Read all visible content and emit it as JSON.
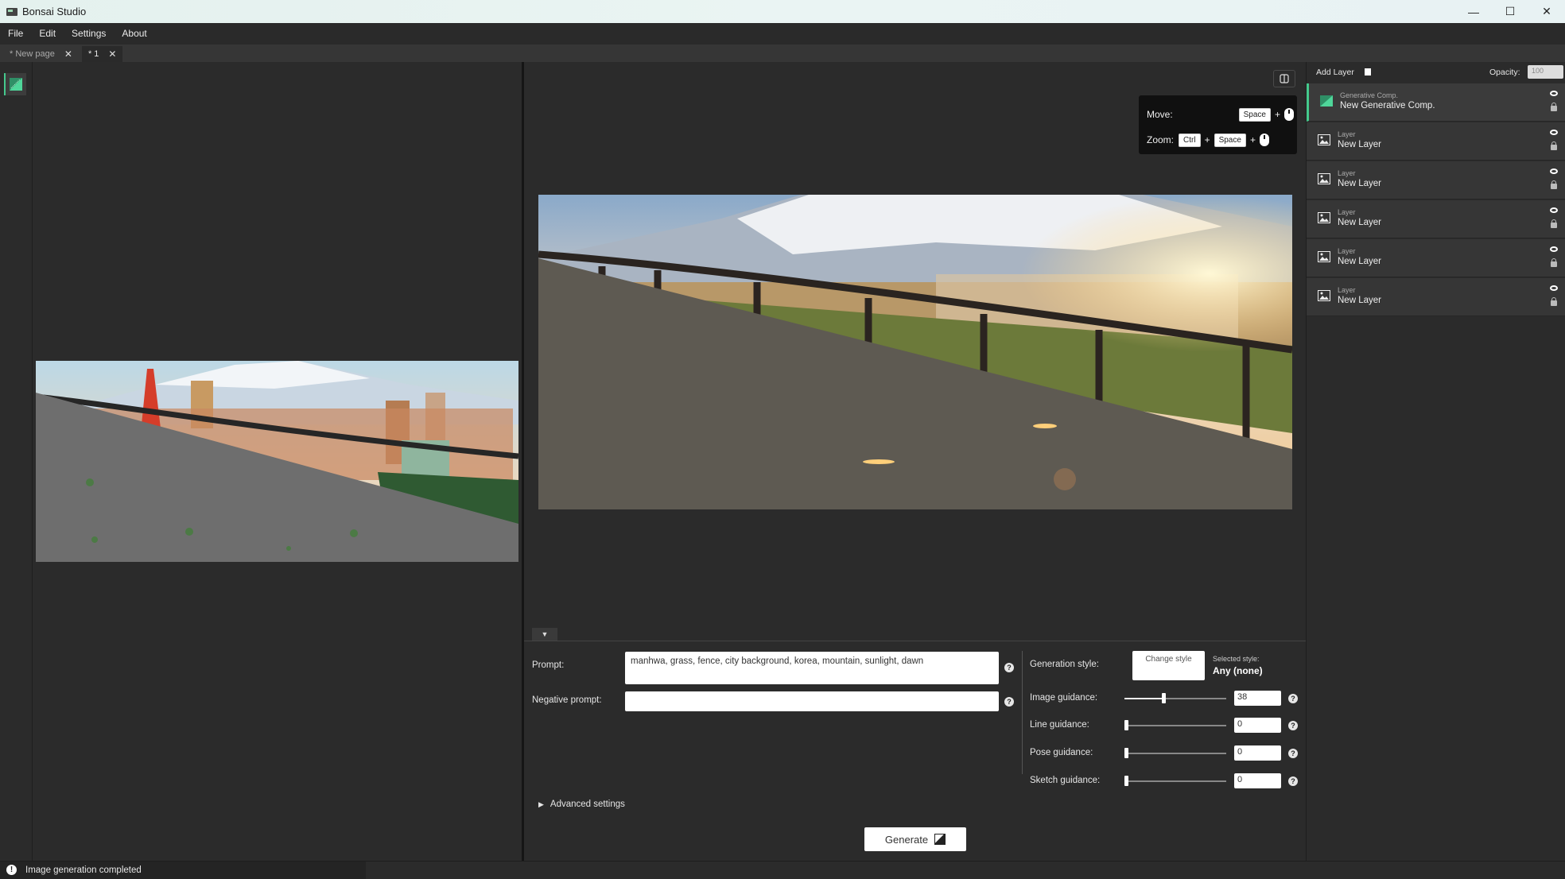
{
  "window": {
    "title": "Bonsai Studio",
    "minimize": "—",
    "maximize": "☐",
    "close": "✕"
  },
  "menu": [
    "File",
    "Edit",
    "Settings",
    "About"
  ],
  "tabs": [
    {
      "label": "* New page",
      "close": "✕"
    },
    {
      "label": "* 1",
      "close": "✕"
    }
  ],
  "tools": {
    "active_icon": "generative-comp-icon"
  },
  "shortcuts": {
    "move_label": "Move:",
    "zoom_label": "Zoom:",
    "space_key": "Space",
    "ctrl_key": "Ctrl",
    "plus": "+"
  },
  "panel_toggle": "▼",
  "form": {
    "prompt_label": "Prompt:",
    "prompt_value": "manhwa,                                            grass, fence, city background, korea, mountain, sunlight, dawn",
    "negative_label": "Negative prompt:",
    "negative_value": "",
    "help": "?",
    "gen_style_label": "Generation style:",
    "change_style": "Change style",
    "selected_style_caption": "Selected style:",
    "selected_style_value": "Any (none)",
    "guidance": [
      {
        "label": "Image guidance:",
        "value": "38",
        "fraction": 0.38
      },
      {
        "label": "Line guidance:",
        "value": "0",
        "fraction": 0
      },
      {
        "label": "Pose guidance:",
        "value": "0",
        "fraction": 0
      },
      {
        "label": "Sketch guidance:",
        "value": "0",
        "fraction": 0
      }
    ],
    "advanced": "Advanced settings",
    "advanced_arrow": "▶",
    "generate": "Generate"
  },
  "layers": {
    "add_layer": "Add Layer",
    "opacity_label": "Opacity:",
    "opacity_value": "100",
    "items": [
      {
        "type": "Generative Comp.",
        "name": "New Generative Comp.",
        "active": true
      },
      {
        "type": "Layer",
        "name": "New Layer",
        "active": false
      },
      {
        "type": "Layer",
        "name": "New Layer",
        "active": false
      },
      {
        "type": "Layer",
        "name": "New Layer",
        "active": false
      },
      {
        "type": "Layer",
        "name": "New Layer",
        "active": false
      },
      {
        "type": "Layer",
        "name": "New Layer",
        "active": false
      }
    ]
  },
  "status": {
    "icon": "!",
    "message": "Image generation completed"
  },
  "colors": {
    "accent": "#45c98d",
    "background": "#2b2b2b"
  }
}
